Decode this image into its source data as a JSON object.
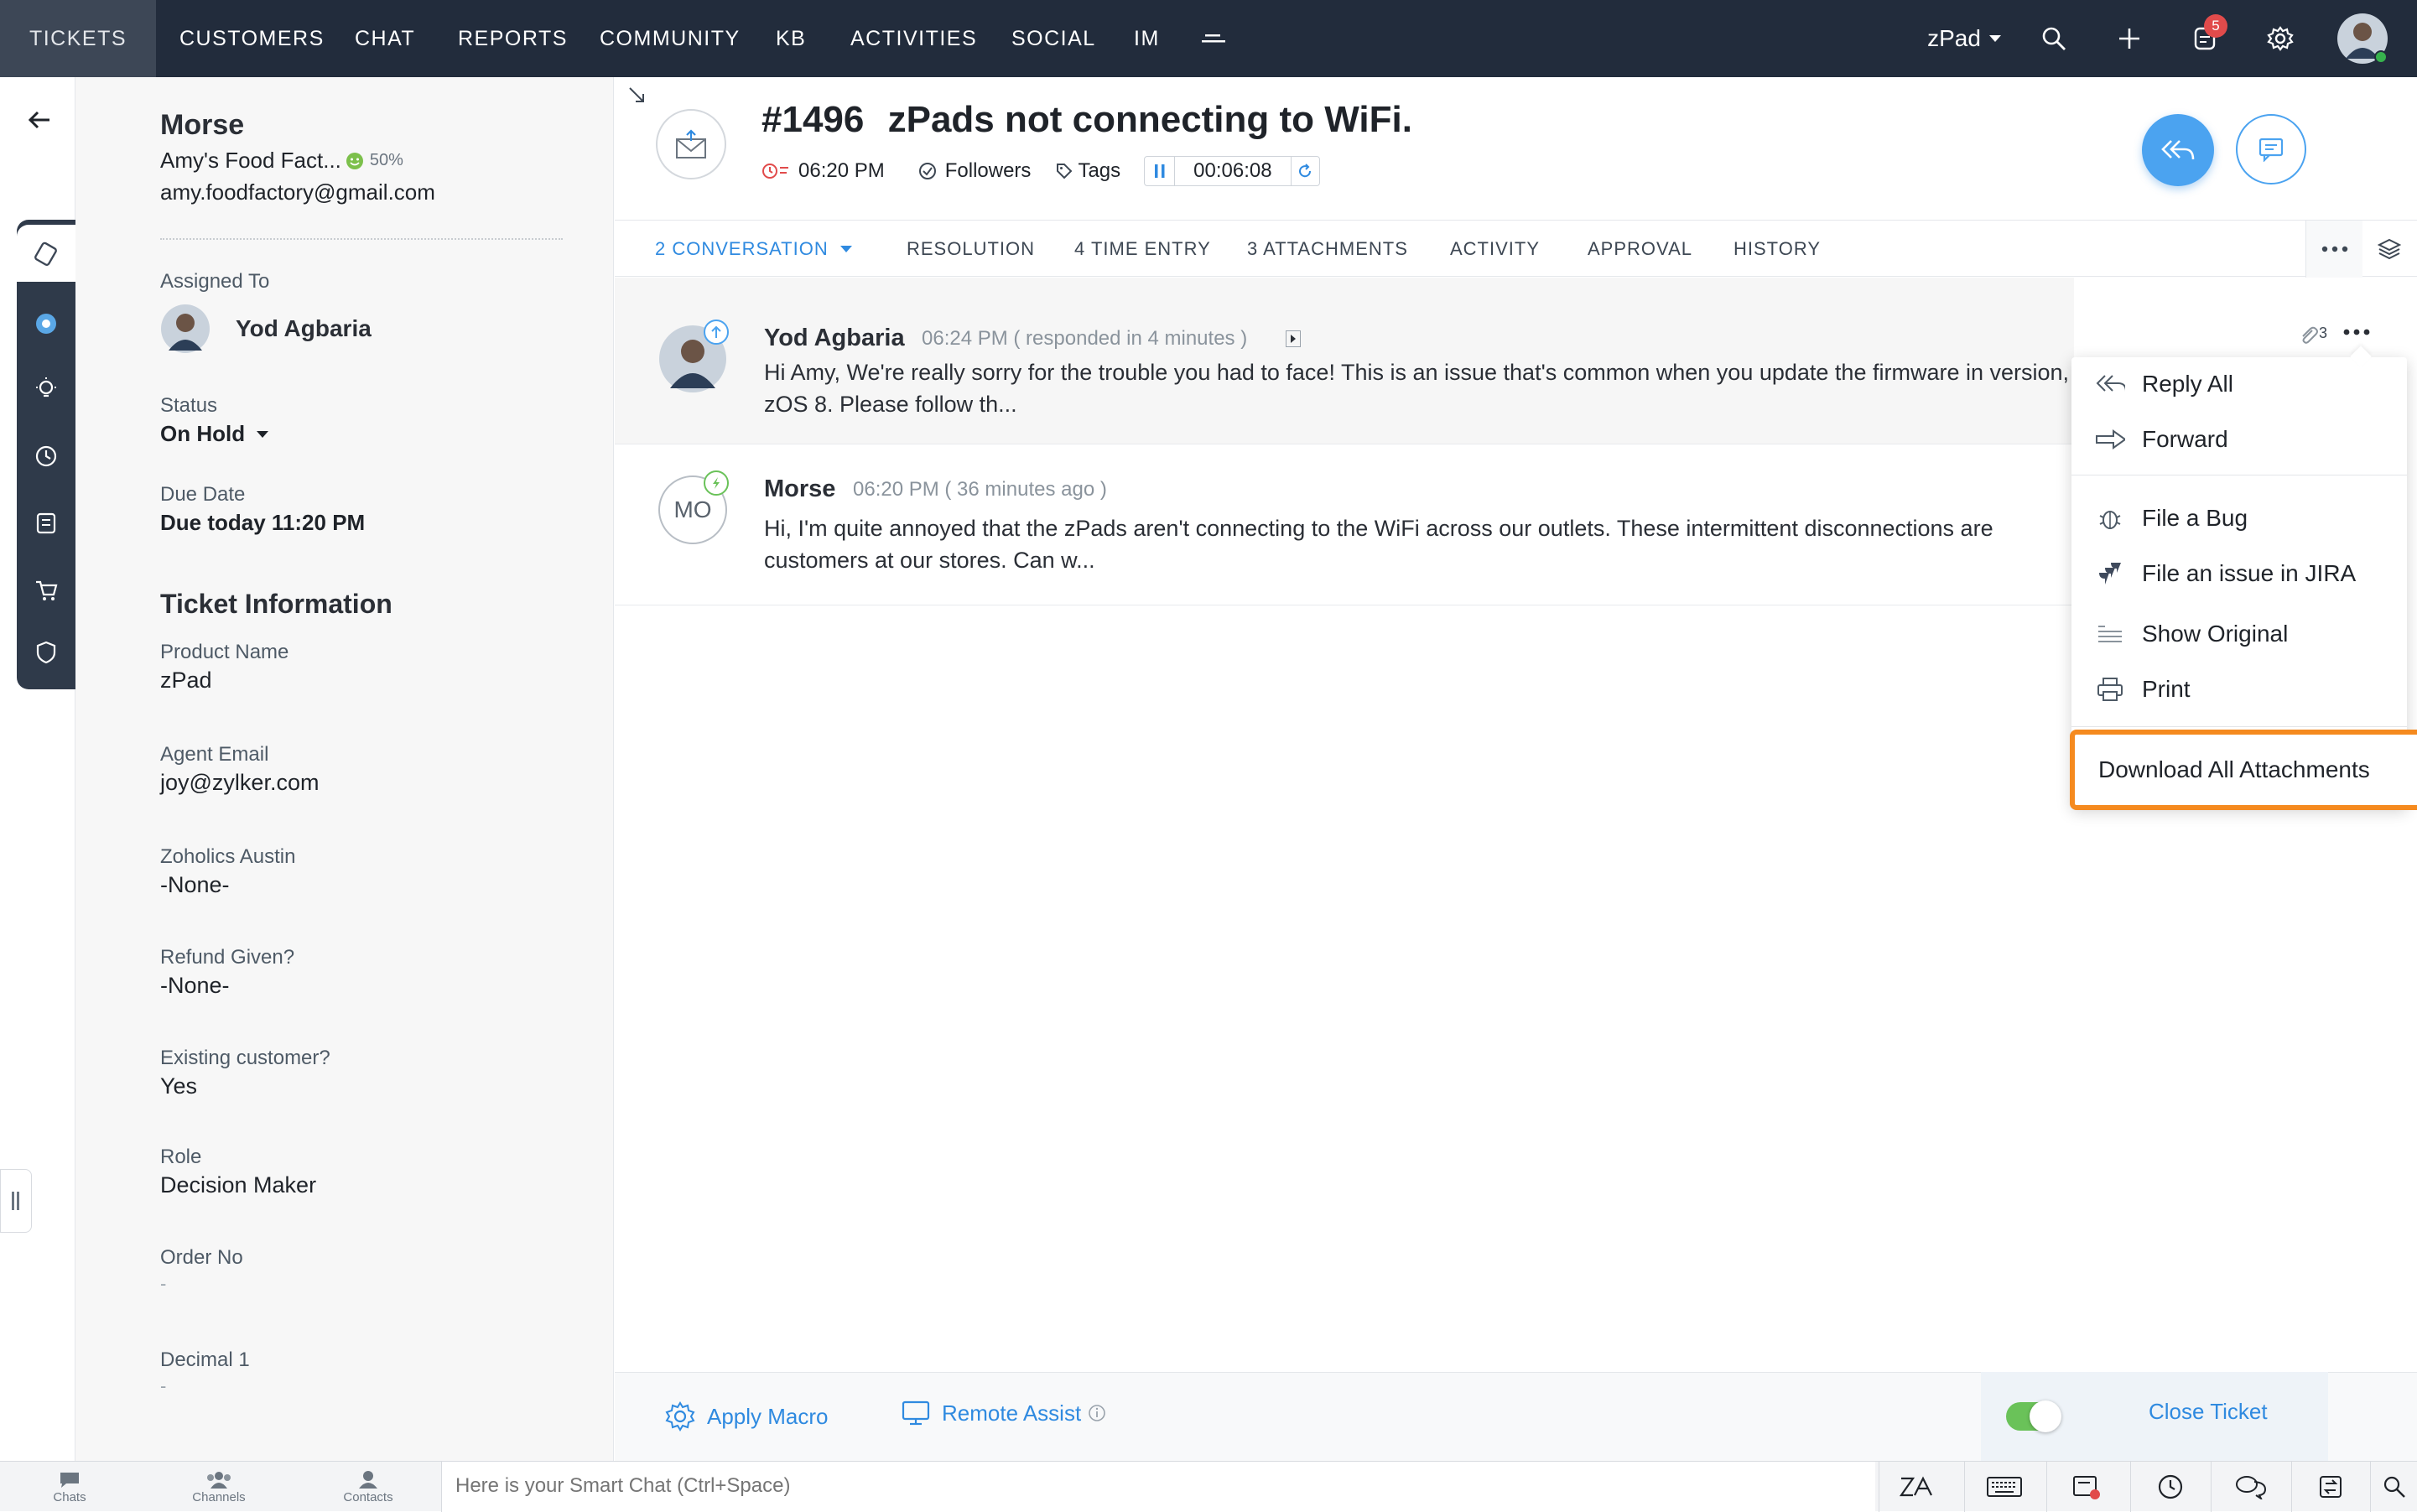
{
  "nav": {
    "tabs": [
      "TICKETS",
      "CUSTOMERS",
      "CHAT",
      "REPORTS",
      "COMMUNITY",
      "KB",
      "ACTIVITIES",
      "SOCIAL",
      "IM"
    ],
    "active_tab": "TICKETS",
    "department": "zPad",
    "notification_count": "5"
  },
  "customer": {
    "name": "Morse",
    "company": "Amy's Food Fact...",
    "happiness": "50%",
    "email": "amy.foodfactory@gmail.com"
  },
  "assignment": {
    "label": "Assigned To",
    "agent": "Yod Agbaria"
  },
  "status": {
    "label": "Status",
    "value": "On Hold"
  },
  "due": {
    "label": "Due Date",
    "value": "Due today 11:20 PM"
  },
  "ticket_info": {
    "heading": "Ticket Information",
    "fields": [
      {
        "label": "Product Name",
        "value": "zPad"
      },
      {
        "label": "Agent Email",
        "value": "joy@zylker.com"
      },
      {
        "label": "Zoholics Austin",
        "value": "-None-"
      },
      {
        "label": "Refund Given?",
        "value": "-None-"
      },
      {
        "label": "Existing customer?",
        "value": "Yes"
      },
      {
        "label": "Role",
        "value": "Decision Maker"
      },
      {
        "label": "Order No",
        "value": "-"
      },
      {
        "label": "Decimal 1",
        "value": "-"
      }
    ]
  },
  "ticket": {
    "number": "#1496",
    "subject": "zPads not connecting to WiFi.",
    "time": "06:20 PM",
    "followers_label": "Followers",
    "tags_label": "Tags",
    "timer": "00:06:08"
  },
  "tabs": {
    "conversation": "2  CONVERSATION",
    "resolution": "RESOLUTION",
    "time_entry": "4 TIME ENTRY",
    "attachments": "3 ATTACHMENTS",
    "activity": "ACTIVITY",
    "approval": "APPROVAL",
    "history": "HISTORY"
  },
  "threads": [
    {
      "author": "Yod Agbaria",
      "meta": "06:24 PM ( responded in 4 minutes )",
      "body": "Hi Amy, We're really sorry for the trouble you had to face! This is an issue that's common when you update the firmware in version, zOS 8. Please follow th...",
      "attachment_count": "3"
    },
    {
      "author": "Morse",
      "initials": "MO",
      "meta": "06:20 PM ( 36 minutes ago )",
      "body": "Hi, I'm quite annoyed that the zPads aren't connecting to the WiFi across our outlets. These intermittent disconnections are customers at our stores. Can w..."
    }
  ],
  "thread_menu": {
    "reply_all": "Reply All",
    "forward": "Forward",
    "file_bug": "File a Bug",
    "file_jira": "File an issue in JIRA",
    "show_original": "Show Original",
    "print": "Print",
    "download_all": "Download All Attachments"
  },
  "footer": {
    "apply_macro": "Apply Macro",
    "remote_assist": "Remote Assist",
    "close_ticket": "Close Ticket"
  },
  "bottombar": {
    "chats": "Chats",
    "channels": "Channels",
    "contacts": "Contacts",
    "smart_chat_placeholder": "Here is your Smart Chat (Ctrl+Space)"
  },
  "colors": {
    "nav_bg": "#222c3c",
    "accent_blue": "#2f8ae0",
    "highlight_orange": "#f58a1f",
    "badge_red": "#e14b4b"
  }
}
